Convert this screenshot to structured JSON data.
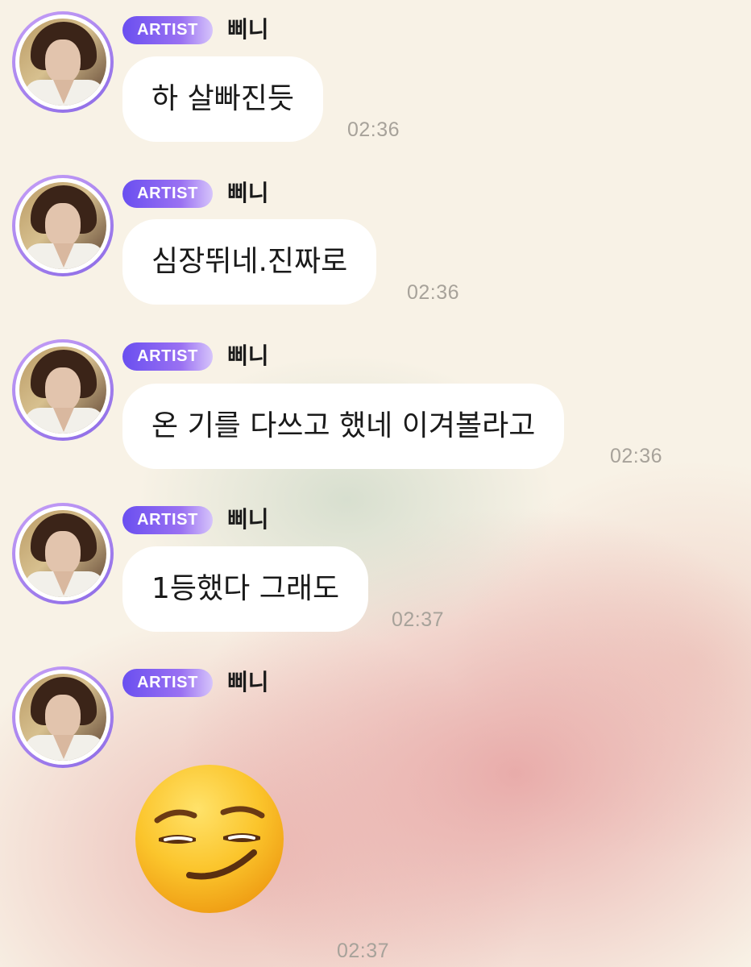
{
  "messages": [
    {
      "badge": "ARTIST",
      "name": "삐니",
      "text": "하 살빠진듯",
      "time": "02:36"
    },
    {
      "badge": "ARTIST",
      "name": "삐니",
      "text": "심장뛰네.진짜로",
      "time": "02:36"
    },
    {
      "badge": "ARTIST",
      "name": "삐니",
      "text": "온 기를 다쓰고 했네 이겨볼라고",
      "time": "02:36"
    },
    {
      "badge": "ARTIST",
      "name": "삐니",
      "text": "1등했다 그래도",
      "time": "02:37"
    },
    {
      "badge": "ARTIST",
      "name": "삐니",
      "emoji": "smirking-face",
      "time": "02:37"
    }
  ],
  "colors": {
    "badge_start": "#6a4ff0",
    "badge_end": "#d6c4fb",
    "bubble": "#ffffff",
    "timestamp": "#a7a29a"
  }
}
